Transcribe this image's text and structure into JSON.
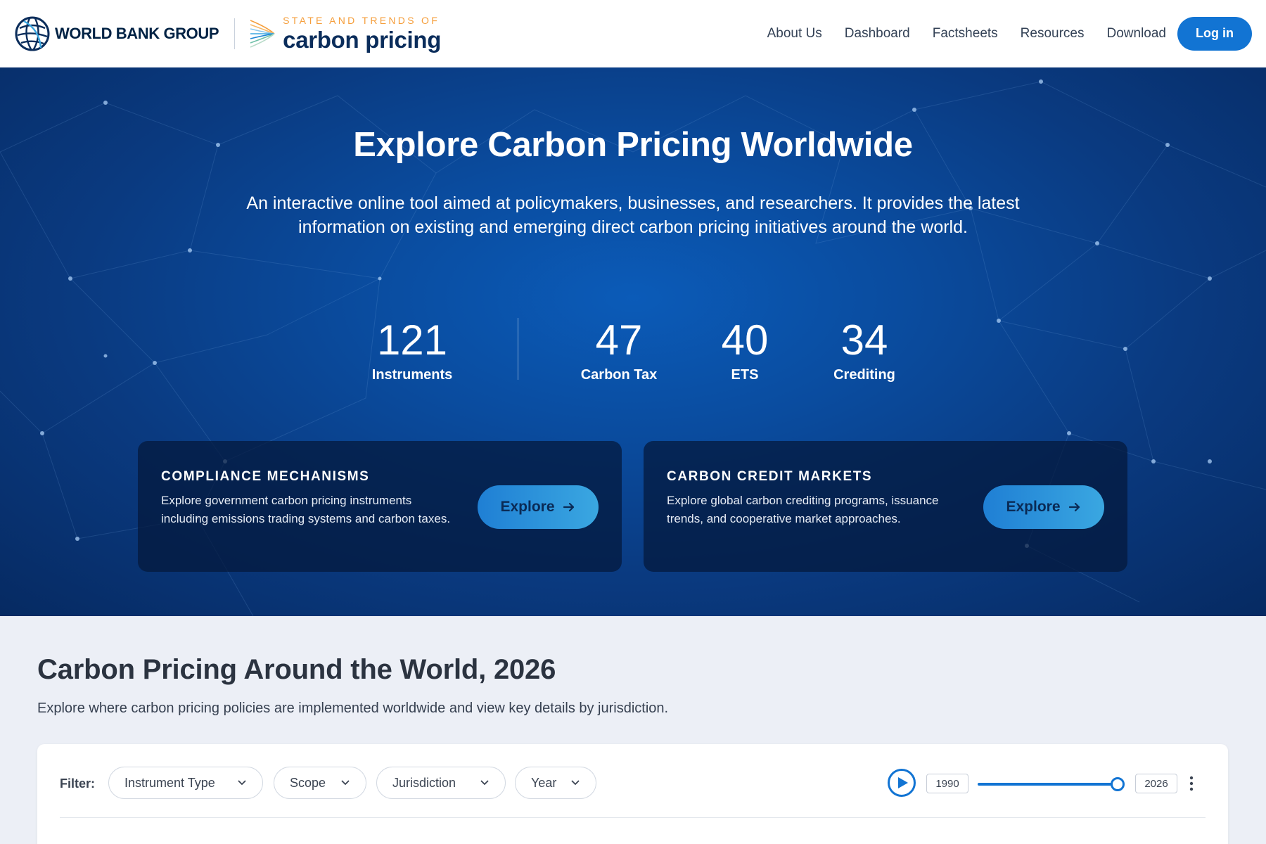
{
  "header": {
    "org_name": "WORLD BANK GROUP",
    "product_tagline": "STATE AND TRENDS OF",
    "product_name": "carbon pricing",
    "nav": [
      "About Us",
      "Dashboard",
      "Factsheets",
      "Resources",
      "Download"
    ],
    "login_label": "Log in"
  },
  "hero": {
    "title": "Explore Carbon Pricing Worldwide",
    "subtitle": "An interactive online tool aimed at policymakers, businesses, and researchers. It provides the latest information on existing and emerging direct carbon pricing initiatives around the world.",
    "stats": [
      {
        "value": "121",
        "label": "Instruments"
      },
      {
        "value": "47",
        "label": "Carbon Tax"
      },
      {
        "value": "40",
        "label": "ETS"
      },
      {
        "value": "34",
        "label": "Crediting"
      }
    ],
    "cards": [
      {
        "title": "COMPLIANCE MECHANISMS",
        "description": "Explore government carbon pricing instruments including emissions trading systems and carbon taxes.",
        "button": "Explore"
      },
      {
        "title": "CARBON CREDIT MARKETS",
        "description": "Explore global carbon crediting programs, issuance trends, and cooperative market approaches.",
        "button": "Explore"
      }
    ]
  },
  "section": {
    "title": "Carbon Pricing Around the World, 2026",
    "subtitle": "Explore where carbon pricing policies are implemented worldwide and view key details by jurisdiction."
  },
  "filters": {
    "label": "Filter:",
    "dropdowns": [
      "Instrument Type",
      "Scope",
      "Jurisdiction",
      "Year"
    ],
    "year_start": "1990",
    "year_end": "2026",
    "slider_position": 1.0
  },
  "colors": {
    "brand_blue": "#1274d3",
    "navy": "#0b2d5b",
    "accent_orange": "#f59e3b",
    "hero_bg": "#0a4c9f"
  },
  "icons": [
    "globe-icon",
    "carbon-pricing-mark-icon",
    "arrow-right-icon",
    "chevron-down-icon",
    "play-icon",
    "more-vertical-icon"
  ]
}
